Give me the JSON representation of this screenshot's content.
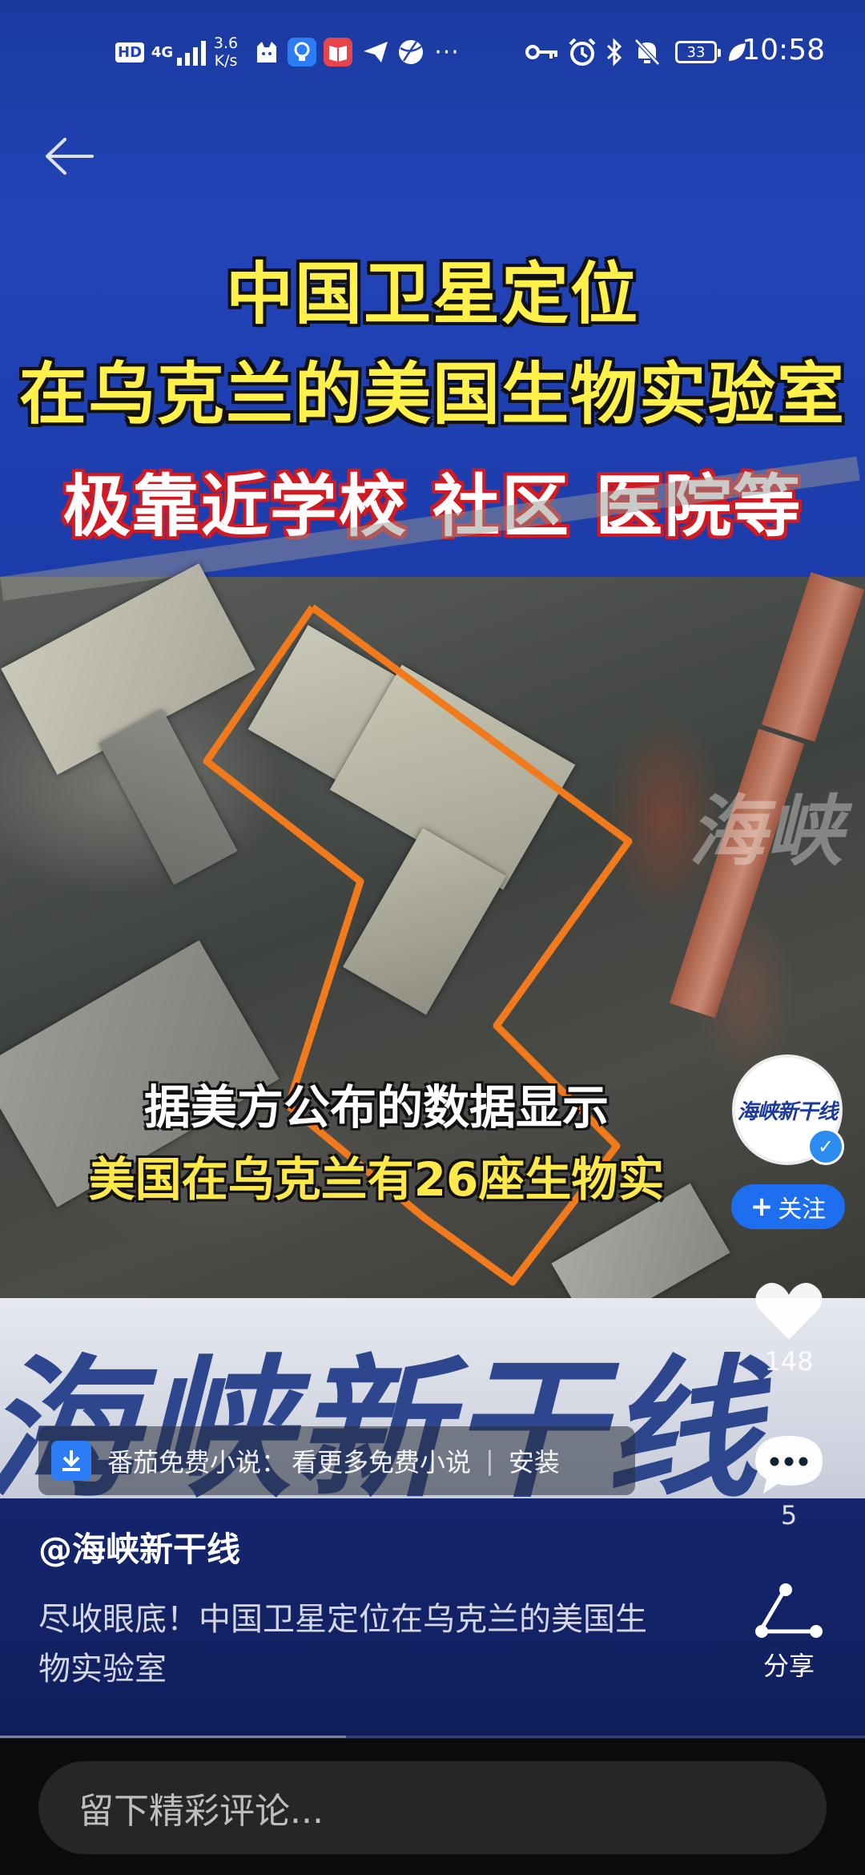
{
  "status_bar": {
    "network": "4G",
    "hd_label": "HD",
    "speed": "3.6\nK/s",
    "battery": "33",
    "time": "10:58"
  },
  "video": {
    "title_line1": "中国卫星定位",
    "title_line2": "在乌克兰的美国生物实验室",
    "title_line3": "极靠近学校 社区 医院等",
    "caption_line1": "据美方公布的数据显示",
    "caption_line2": "美国在乌克兰有26座生物实",
    "channel_watermark": "海峡新干线"
  },
  "creator": {
    "avatar_logo": "海峡新干线",
    "follow_label": "关注"
  },
  "actions": {
    "likes": "148",
    "comments": "5",
    "share_label": "分享"
  },
  "ad": {
    "app": "番茄免费小说",
    "separator": "：",
    "text": "看更多免费小说",
    "divider": "|",
    "cta": "安装"
  },
  "post": {
    "author": "@海峡新干线",
    "description": "尽收眼底！中国卫星定位在乌克兰的美国生物实验室"
  },
  "progress": {
    "fraction": 0.4
  },
  "comment": {
    "placeholder": "留下精彩评论..."
  },
  "colors": {
    "header_blue": "#2244b8",
    "title_yellow": "#fff14a",
    "title_red_outline": "#d11a22",
    "outline_orange": "#f07a1c",
    "follow_blue": "#1e6ef0"
  }
}
